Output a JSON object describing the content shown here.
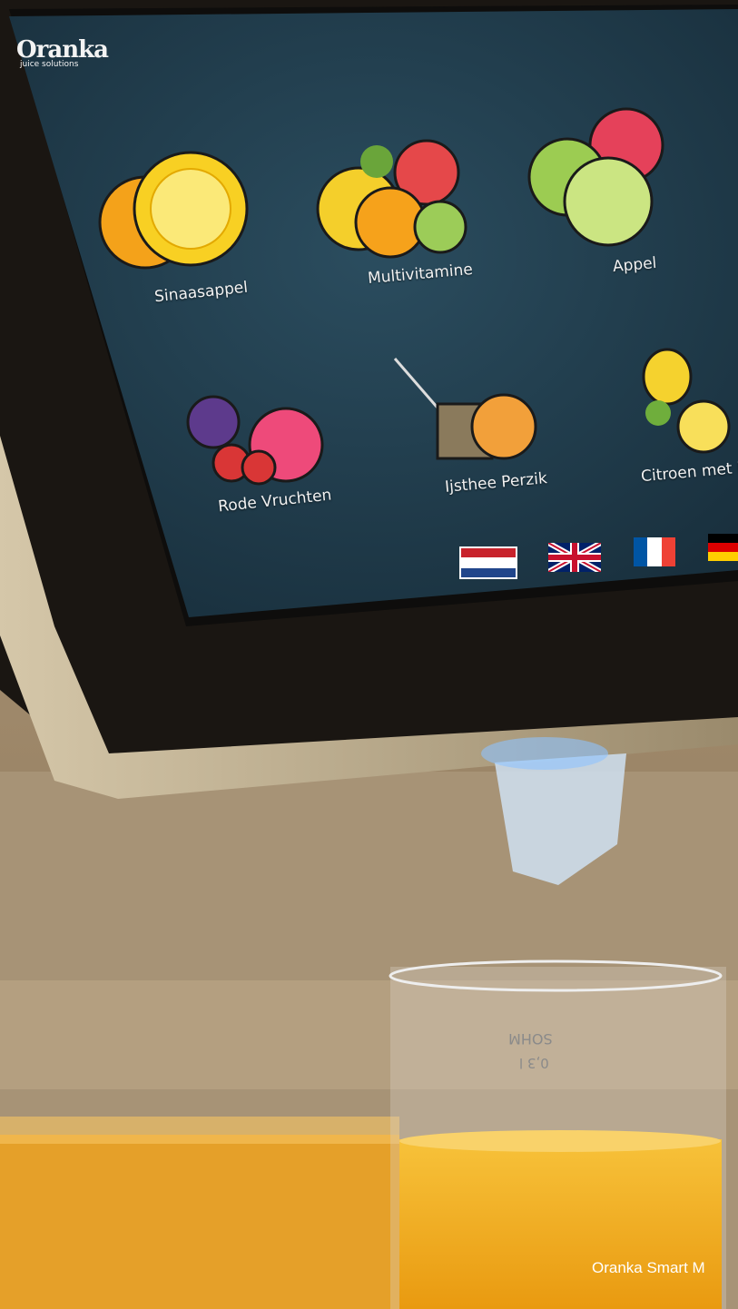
{
  "brand": {
    "name": "Oranka",
    "tagline": "juice solutions"
  },
  "drinks": [
    {
      "label": "Sinaasappel",
      "icon": "orange-fruit-icon"
    },
    {
      "label": "Multivitamine",
      "icon": "mixed-fruit-icon"
    },
    {
      "label": "Appel",
      "icon": "apple-fruit-icon"
    },
    {
      "label": "Rode Vruchten",
      "icon": "red-berries-icon"
    },
    {
      "label": "Ijsthee Perzik",
      "icon": "ice-tea-peach-icon"
    },
    {
      "label": "Citroen met M",
      "icon": "lemon-mint-icon"
    }
  ],
  "languages": [
    {
      "code": "nl",
      "icon": "dutch-flag-icon",
      "selected": true
    },
    {
      "code": "en",
      "icon": "uk-flag-icon",
      "selected": false
    },
    {
      "code": "fr",
      "icon": "french-flag-icon",
      "selected": false
    },
    {
      "code": "de",
      "icon": "german-flag-icon",
      "selected": false
    }
  ],
  "glass": {
    "brand": "SOHM",
    "volume": "0,3 l"
  },
  "caption": "Oranka Smart M",
  "colors": {
    "screen": "#1f3a4a",
    "juice": "#f2a516",
    "frame": "#c9b99a"
  }
}
